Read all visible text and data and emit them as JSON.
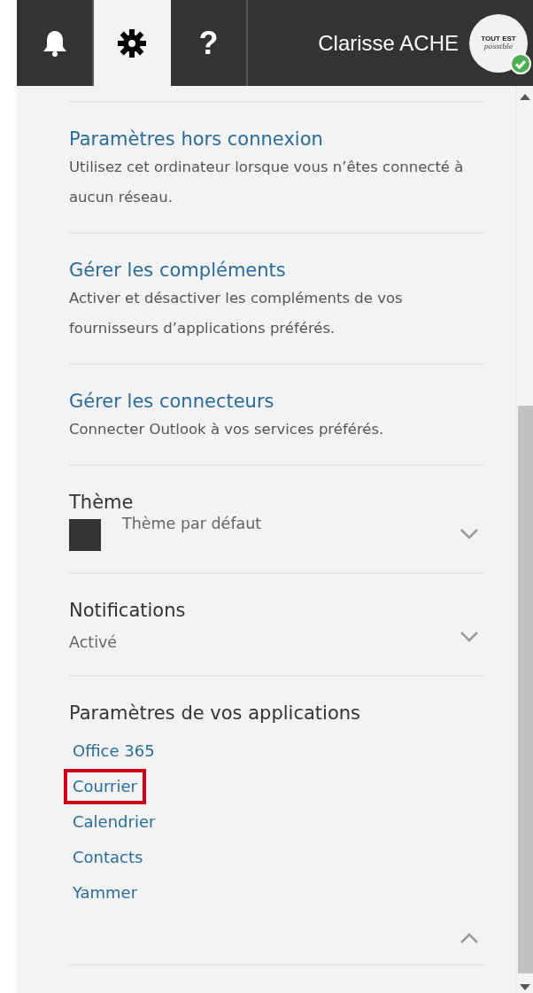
{
  "header": {
    "tabs": [
      {
        "kind": "bell",
        "selected": false
      },
      {
        "kind": "gear",
        "selected": true
      },
      {
        "kind": "text",
        "label": "?",
        "selected": false
      }
    ],
    "user_name": "Clarisse ACHE",
    "avatar": {
      "line_1": "TOUT EST",
      "line_2": "possible",
      "online": true
    }
  },
  "sections": [
    {
      "kind": "link",
      "title": "Paramètres hors connexion",
      "description": "Utilisez cet ordinateur lorsque vous n’êtes connecté à aucun réseau."
    },
    {
      "kind": "link",
      "title": "Gérer les compléments",
      "description": "Activer et désactiver les compléments de vos fournisseurs d’applications préférés."
    },
    {
      "kind": "link",
      "title": "Gérer les connecteurs",
      "description": "Connecter Outlook à vos services préférés."
    },
    {
      "kind": "select",
      "title": "Thème",
      "value": "Thème par défaut",
      "color": "#333333",
      "expanded": false
    },
    {
      "kind": "select",
      "title": "Notifications",
      "value": "Activé",
      "expanded": false
    },
    {
      "kind": "links",
      "title": "Paramètres de vos applications",
      "expanded": true,
      "links": [
        {
          "label": "Office 365",
          "highlighted": false
        },
        {
          "label": "Courrier",
          "highlighted": true
        },
        {
          "label": "Calendrier",
          "highlighted": false
        },
        {
          "label": "Contacts",
          "highlighted": false
        },
        {
          "label": "Yammer",
          "highlighted": false
        }
      ]
    }
  ]
}
